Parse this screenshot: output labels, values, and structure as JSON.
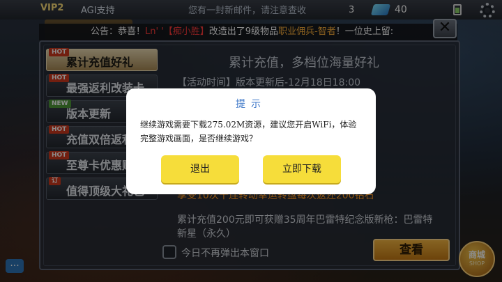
{
  "topbar": {
    "vip": "VIP2",
    "name": "AGI支持",
    "mail_tip": "您有一封新邮件，请注意查收",
    "coin_count": "3",
    "gem_count": "40"
  },
  "announcement": {
    "prefix": "公告：恭喜！",
    "player": "Ln' '【痴小胜】",
    "middle": "改造出了9级物品",
    "item": "职业佣兵-智者",
    "suffix": "！一位史上留:"
  },
  "close_label": "✕",
  "sidebar": {
    "items": [
      {
        "badge": "HOT",
        "label": "累计充值好礼",
        "active": true
      },
      {
        "badge": "HOT",
        "label": "最强返利改装卡",
        "active": false
      },
      {
        "badge": "NEW",
        "label": "版本更新",
        "active": false
      },
      {
        "badge": "HOT",
        "label": "充值双倍返利",
        "active": false
      },
      {
        "badge": "HOT",
        "label": "至尊卡优惠购",
        "active": false
      },
      {
        "badge": "订",
        "label": "值得顶级大礼包",
        "active": false
      }
    ]
  },
  "content": {
    "title": "累计充值，多档位海量好礼",
    "time": "【活动时间】版本更新后-12月18日18:00",
    "orange_line": "享受10次十连转动幸运转盘每次返还200钻石",
    "desc": "累计充值200元即可获赠35周年巴雷特纪念版新枪：巴雷特新星（永久）"
  },
  "checkbox_label": "今日不再弹出本窗口",
  "view_button": "查看",
  "shop": {
    "label": "商城",
    "sub": "SHOP"
  },
  "chat_icon_label": "...",
  "dialog": {
    "title": "提示",
    "message": "继续游戏需要下载275.02M资源，建议您开启WiFi，体验完整游戏画面，是否继续游戏？",
    "exit_button": "退出",
    "download_button": "立即下载"
  }
}
